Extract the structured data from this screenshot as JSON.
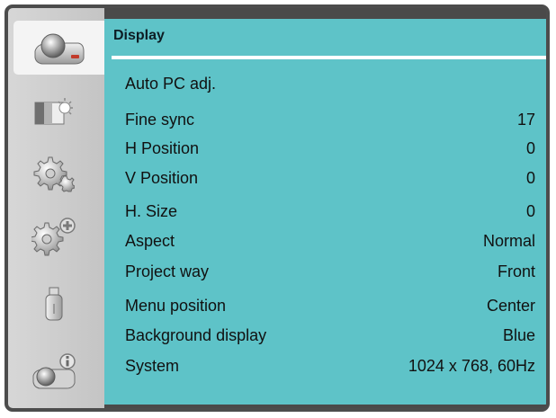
{
  "header": {
    "title": "Display"
  },
  "menu_items": [
    {
      "label": "Auto PC adj.",
      "value": ""
    },
    {
      "label": "Fine sync",
      "value": "17"
    },
    {
      "label": "H Position",
      "value": "0"
    },
    {
      "label": "V Position",
      "value": "0"
    },
    {
      "label": "H. Size",
      "value": "0"
    },
    {
      "label": "Aspect",
      "value": "Normal"
    },
    {
      "label": "Project way",
      "value": "Front"
    },
    {
      "label": "Menu position",
      "value": "Center"
    },
    {
      "label": "Background display",
      "value": "Blue"
    },
    {
      "label": "System",
      "value": "1024 x 768, 60Hz"
    }
  ],
  "sidebar": {
    "tabs": [
      {
        "icon": "projector-icon",
        "selected": true
      },
      {
        "icon": "picture-adjust-icon",
        "selected": false
      },
      {
        "icon": "gears-icon",
        "selected": false
      },
      {
        "icon": "gears-plus-icon",
        "selected": false
      },
      {
        "icon": "usb-drive-icon",
        "selected": false
      },
      {
        "icon": "projector-info-icon",
        "selected": false
      }
    ]
  },
  "colors": {
    "content_bg": "#5ec3c8",
    "sidebar_bg": "#cdcdcd",
    "frame": "#4a4a4a",
    "selected_tab": "#f4f4f4",
    "text": "#111111"
  }
}
